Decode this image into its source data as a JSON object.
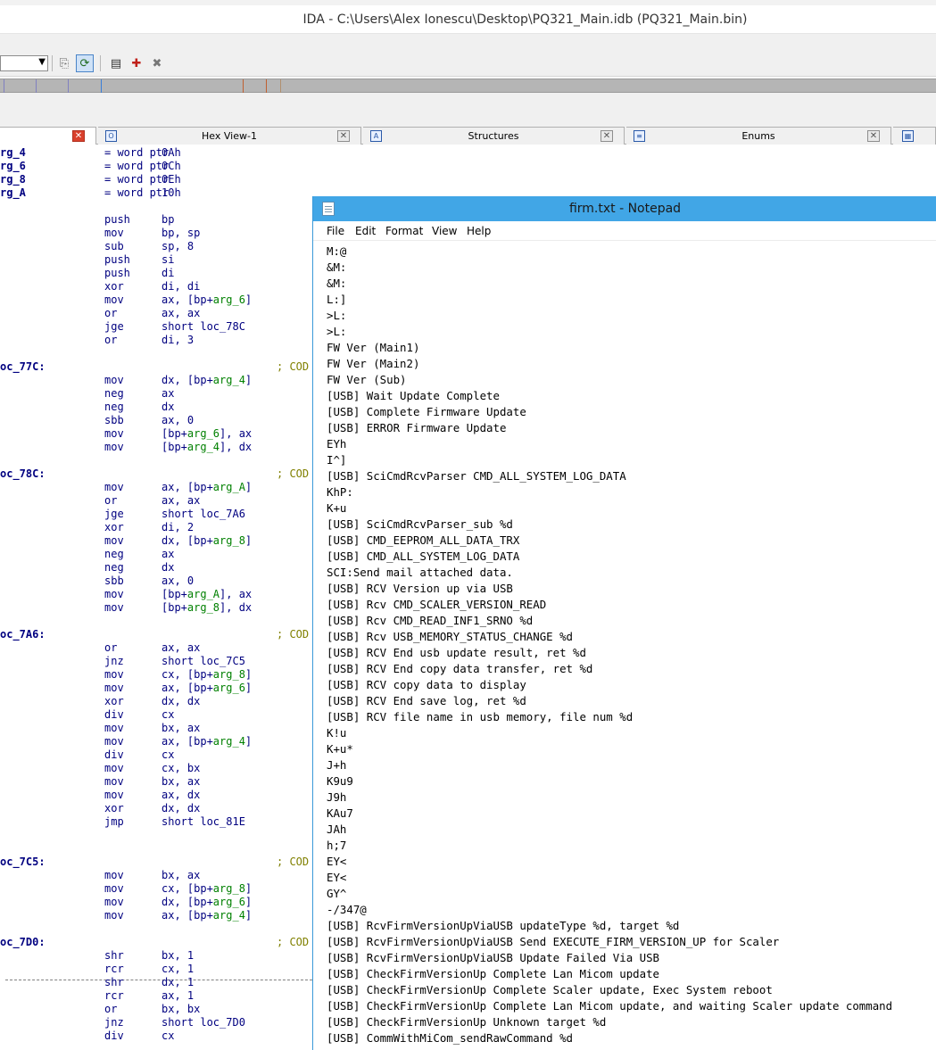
{
  "ida": {
    "title": "IDA - C:\\Users\\Alex Ionescu\\Desktop\\PQ321_Main.idb (PQ321_Main.bin)",
    "tabs": [
      {
        "label": ""
      },
      {
        "label": "Hex View-1"
      },
      {
        "label": "Structures"
      },
      {
        "label": "Enums"
      }
    ],
    "listing": [
      {
        "label": "rg_4",
        "mn": "= word ptr",
        "op": "0Ah"
      },
      {
        "label": "rg_6",
        "mn": "= word ptr",
        "op": "0Ch"
      },
      {
        "label": "rg_8",
        "mn": "= word ptr",
        "op": "0Eh"
      },
      {
        "label": "rg_A",
        "mn": "= word ptr",
        "op": "10h"
      },
      {
        "label": "",
        "mn": "",
        "op": ""
      },
      {
        "label": "",
        "mn": "push",
        "op": "bp"
      },
      {
        "label": "",
        "mn": "mov",
        "op": "bp, sp"
      },
      {
        "label": "",
        "mn": "sub",
        "op": "sp, 8"
      },
      {
        "label": "",
        "mn": "push",
        "op": "si"
      },
      {
        "label": "",
        "mn": "push",
        "op": "di"
      },
      {
        "label": "",
        "mn": "xor",
        "op": "di, di"
      },
      {
        "label": "",
        "mn": "mov",
        "op": "ax, [bp+arg_6]"
      },
      {
        "label": "",
        "mn": "or",
        "op": "ax, ax"
      },
      {
        "label": "",
        "mn": "jge",
        "op": "short loc_78C"
      },
      {
        "label": "",
        "mn": "or",
        "op": "di, 3"
      },
      {
        "label": "",
        "mn": "",
        "op": ""
      },
      {
        "label": "oc_77C:",
        "mn": "",
        "op": "",
        "cmt": "; COD"
      },
      {
        "label": "",
        "mn": "mov",
        "op": "dx, [bp+arg_4]"
      },
      {
        "label": "",
        "mn": "neg",
        "op": "ax"
      },
      {
        "label": "",
        "mn": "neg",
        "op": "dx"
      },
      {
        "label": "",
        "mn": "sbb",
        "op": "ax, 0"
      },
      {
        "label": "",
        "mn": "mov",
        "op": "[bp+arg_6], ax"
      },
      {
        "label": "",
        "mn": "mov",
        "op": "[bp+arg_4], dx"
      },
      {
        "label": "",
        "mn": "",
        "op": ""
      },
      {
        "label": "oc_78C:",
        "mn": "",
        "op": "",
        "cmt": "; COD"
      },
      {
        "label": "",
        "mn": "mov",
        "op": "ax, [bp+arg_A]"
      },
      {
        "label": "",
        "mn": "or",
        "op": "ax, ax"
      },
      {
        "label": "",
        "mn": "jge",
        "op": "short loc_7A6"
      },
      {
        "label": "",
        "mn": "xor",
        "op": "di, 2"
      },
      {
        "label": "",
        "mn": "mov",
        "op": "dx, [bp+arg_8]"
      },
      {
        "label": "",
        "mn": "neg",
        "op": "ax"
      },
      {
        "label": "",
        "mn": "neg",
        "op": "dx"
      },
      {
        "label": "",
        "mn": "sbb",
        "op": "ax, 0"
      },
      {
        "label": "",
        "mn": "mov",
        "op": "[bp+arg_A], ax"
      },
      {
        "label": "",
        "mn": "mov",
        "op": "[bp+arg_8], dx"
      },
      {
        "label": "",
        "mn": "",
        "op": ""
      },
      {
        "label": "oc_7A6:",
        "mn": "",
        "op": "",
        "cmt": "; COD"
      },
      {
        "label": "",
        "mn": "or",
        "op": "ax, ax"
      },
      {
        "label": "",
        "mn": "jnz",
        "op": "short loc_7C5"
      },
      {
        "label": "",
        "mn": "mov",
        "op": "cx, [bp+arg_8]"
      },
      {
        "label": "",
        "mn": "mov",
        "op": "ax, [bp+arg_6]"
      },
      {
        "label": "",
        "mn": "xor",
        "op": "dx, dx"
      },
      {
        "label": "",
        "mn": "div",
        "op": "cx"
      },
      {
        "label": "",
        "mn": "mov",
        "op": "bx, ax"
      },
      {
        "label": "",
        "mn": "mov",
        "op": "ax, [bp+arg_4]"
      },
      {
        "label": "",
        "mn": "div",
        "op": "cx"
      },
      {
        "label": "",
        "mn": "mov",
        "op": "cx, bx"
      },
      {
        "label": "",
        "mn": "mov",
        "op": "bx, ax"
      },
      {
        "label": "",
        "mn": "mov",
        "op": "ax, dx"
      },
      {
        "label": "",
        "mn": "xor",
        "op": "dx, dx"
      },
      {
        "label": "",
        "mn": "jmp",
        "op": "short loc_81E"
      },
      {
        "label": "",
        "mn": "",
        "op": ""
      },
      {
        "label": "",
        "mn": "",
        "op": ""
      },
      {
        "label": "oc_7C5:",
        "mn": "",
        "op": "",
        "cmt": "; COD"
      },
      {
        "label": "",
        "mn": "mov",
        "op": "bx, ax"
      },
      {
        "label": "",
        "mn": "mov",
        "op": "cx, [bp+arg_8]"
      },
      {
        "label": "",
        "mn": "mov",
        "op": "dx, [bp+arg_6]"
      },
      {
        "label": "",
        "mn": "mov",
        "op": "ax, [bp+arg_4]"
      },
      {
        "label": "",
        "mn": "",
        "op": ""
      },
      {
        "label": "oc_7D0:",
        "mn": "",
        "op": "",
        "cmt": "; COD"
      },
      {
        "label": "",
        "mn": "shr",
        "op": "bx, 1"
      },
      {
        "label": "",
        "mn": "rcr",
        "op": "cx, 1"
      },
      {
        "label": "",
        "mn": "shr",
        "op": "dx, 1"
      },
      {
        "label": "",
        "mn": "rcr",
        "op": "ax, 1"
      },
      {
        "label": "",
        "mn": "or",
        "op": "bx, bx"
      },
      {
        "label": "",
        "mn": "jnz",
        "op": "short loc_7D0"
      },
      {
        "label": "",
        "mn": "div",
        "op": "cx"
      }
    ]
  },
  "notepad": {
    "title": "firm.txt - Notepad",
    "menus": [
      "File",
      "Edit",
      "Format",
      "View",
      "Help"
    ],
    "lines": [
      "M:@",
      "&M:",
      "&M:",
      "L:]",
      ">L:",
      ">L:",
      "FW Ver (Main1)",
      "FW Ver (Main2)",
      "FW Ver (Sub)",
      "[USB] Wait Update Complete",
      "[USB] Complete Firmware Update",
      "[USB] ERROR Firmware Update",
      "EYh",
      "I^]",
      "[USB] SciCmdRcvParser CMD_ALL_SYSTEM_LOG_DATA",
      "KhP:",
      "K+u",
      "[USB] SciCmdRcvParser_sub %d",
      "[USB] CMD_EEPROM_ALL_DATA_TRX",
      "[USB] CMD_ALL_SYSTEM_LOG_DATA",
      "SCI:Send mail attached data.",
      "[USB] RCV Version up via USB",
      "[USB] Rcv CMD_SCALER_VERSION_READ",
      "[USB] Rcv CMD_READ_INF1_SRNO %d",
      "[USB] Rcv USB_MEMORY_STATUS_CHANGE %d",
      "[USB] RCV End usb update result, ret %d",
      "[USB] RCV End copy data transfer, ret %d",
      "[USB] RCV copy data to display",
      "[USB] RCV End save log, ret %d",
      "[USB] RCV file name in usb memory, file num %d",
      "K!u",
      "K+u*",
      "J+h",
      "K9u9",
      "J9h",
      "KAu7",
      "JAh",
      "h;7",
      "EY<",
      "EY<",
      "GY^",
      "-/347@",
      "[USB] RcvFirmVersionUpViaUSB updateType %d, target %d",
      "[USB] RcvFirmVersionUpViaUSB Send EXECUTE_FIRM_VERSION_UP for Scaler",
      "[USB] RcvFirmVersionUpViaUSB Update Failed Via USB",
      "[USB] CheckFirmVersionUp Complete Lan Micom update",
      "[USB] CheckFirmVersionUp Complete Scaler update, Exec System reboot",
      "[USB] CheckFirmVersionUp Complete Lan Micom update, and waiting Scaler update command",
      "[USB] CheckFirmVersionUp Unknown target %d",
      "[USB] CommWithMiCom_sendRawCommand %d"
    ]
  }
}
